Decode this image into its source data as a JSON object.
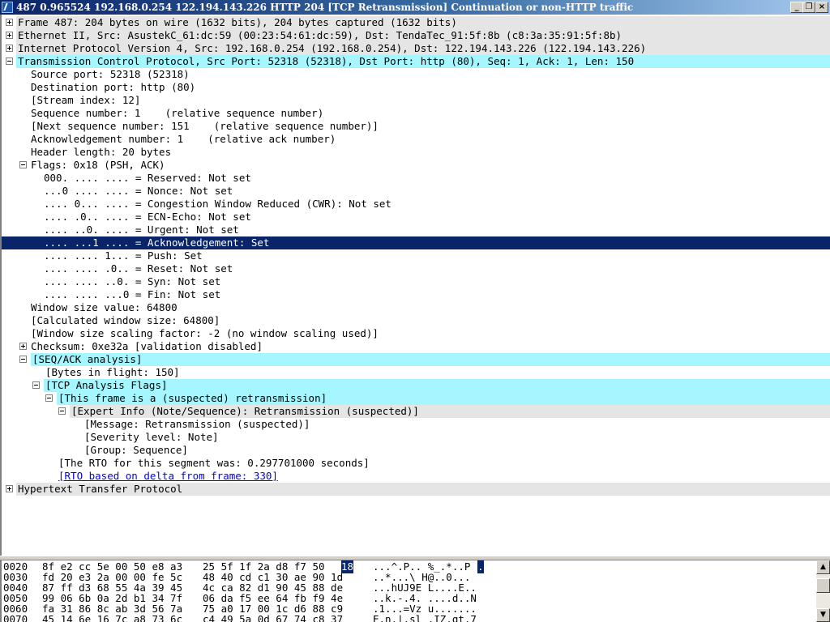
{
  "window": {
    "title": "487 0.965524 192.168.0.254 122.194.143.226 HTTP 204 [TCP Retransmission] Continuation or non-HTTP traffic",
    "minimize_glyph": "_",
    "restore_glyph": "❐",
    "close_glyph": "×"
  },
  "tree": {
    "rows": [
      "Frame 487: 204 bytes on wire (1632 bits), 204 bytes captured (1632 bits)",
      "Ethernet II, Src: AsustekC_61:dc:59 (00:23:54:61:dc:59), Dst: TendaTec_91:5f:8b (c8:3a:35:91:5f:8b)",
      "Internet Protocol Version 4, Src: 192.168.0.254 (192.168.0.254), Dst: 122.194.143.226 (122.194.143.226)",
      "Transmission Control Protocol, Src Port: 52318 (52318), Dst Port: http (80), Seq: 1, Ack: 1, Len: 150",
      "Source port: 52318 (52318)",
      "Destination port: http (80)",
      "[Stream index: 12]",
      "Sequence number: 1    (relative sequence number)",
      "[Next sequence number: 151    (relative sequence number)]",
      "Acknowledgement number: 1    (relative ack number)",
      "Header length: 20 bytes",
      "Flags: 0x18 (PSH, ACK)",
      "000. .... .... = Reserved: Not set",
      "...0 .... .... = Nonce: Not set",
      ".... 0... .... = Congestion Window Reduced (CWR): Not set",
      ".... .0.. .... = ECN-Echo: Not set",
      ".... ..0. .... = Urgent: Not set",
      ".... ...1 .... = Acknowledgement: Set",
      ".... .... 1... = Push: Set",
      ".... .... .0.. = Reset: Not set",
      ".... .... ..0. = Syn: Not set",
      ".... .... ...0 = Fin: Not set",
      "Window size value: 64800",
      "[Calculated window size: 64800]",
      "[Window size scaling factor: -2 (no window scaling used)]",
      "Checksum: 0xe32a [validation disabled]",
      "[SEQ/ACK analysis]",
      "[Bytes in flight: 150]",
      "[TCP Analysis Flags]",
      "[This frame is a (suspected) retransmission]",
      "[Expert Info (Note/Sequence): Retransmission (suspected)]",
      "[Message: Retransmission (suspected)]",
      "[Severity level: Note]",
      "[Group: Sequence]",
      "[The RTO for this segment was: 0.297701000 seconds]",
      "[RTO based on delta from frame: 330]",
      "Hypertext Transfer Protocol"
    ]
  },
  "hex": {
    "rows": [
      {
        "offset": "0020",
        "bytes_a": "8f e2 cc 5e 00 50 e8 a3",
        "bytes_b": "25 5f 1f 2a d8 f7 50",
        "sel_byte": "18",
        "ascii_pre": "...^.P.. %_.*..P",
        "ascii_sel": "."
      },
      {
        "offset": "0030",
        "bytes_a": "fd 20 e3 2a 00 00 fe 5c",
        "bytes_b": "48 40 cd c1 30 ae 90 1d",
        "ascii": "..*...\\ H@..0..."
      },
      {
        "offset": "0040",
        "bytes_a": "87 ff d3 68 55 4a 39 45",
        "bytes_b": "4c ca 82 d1 90 45 88 de",
        "ascii": "...hUJ9E L....E.."
      },
      {
        "offset": "0050",
        "bytes_a": "99 06 6b 0a 2d b1 34 7f",
        "bytes_b": "06 da f5 ee 64 fb f9 4e",
        "ascii": "..k.-.4. ....d..N"
      },
      {
        "offset": "0060",
        "bytes_a": "fa 31 86 8c ab 3d 56 7a",
        "bytes_b": "75 a0 17 00 1c d6 88 c9",
        "ascii": ".1...=Vz u......."
      },
      {
        "offset": "0070",
        "bytes_a": "45 14 6e 16 7c a8 73 6c",
        "bytes_b": "c4 49 5a 0d 67 74 c8 37",
        "ascii": "E.n.|.sl .IZ.gt.7"
      }
    ],
    "scroll_up_glyph": "▲",
    "scroll_down_glyph": "▼"
  },
  "colors": {
    "title_bar": "#0a246a",
    "protocol_header_bg": "#e5e5e5",
    "highlight_cyan": "#a6f6ff",
    "selection": "#0a246a",
    "link": "#0000ee"
  }
}
